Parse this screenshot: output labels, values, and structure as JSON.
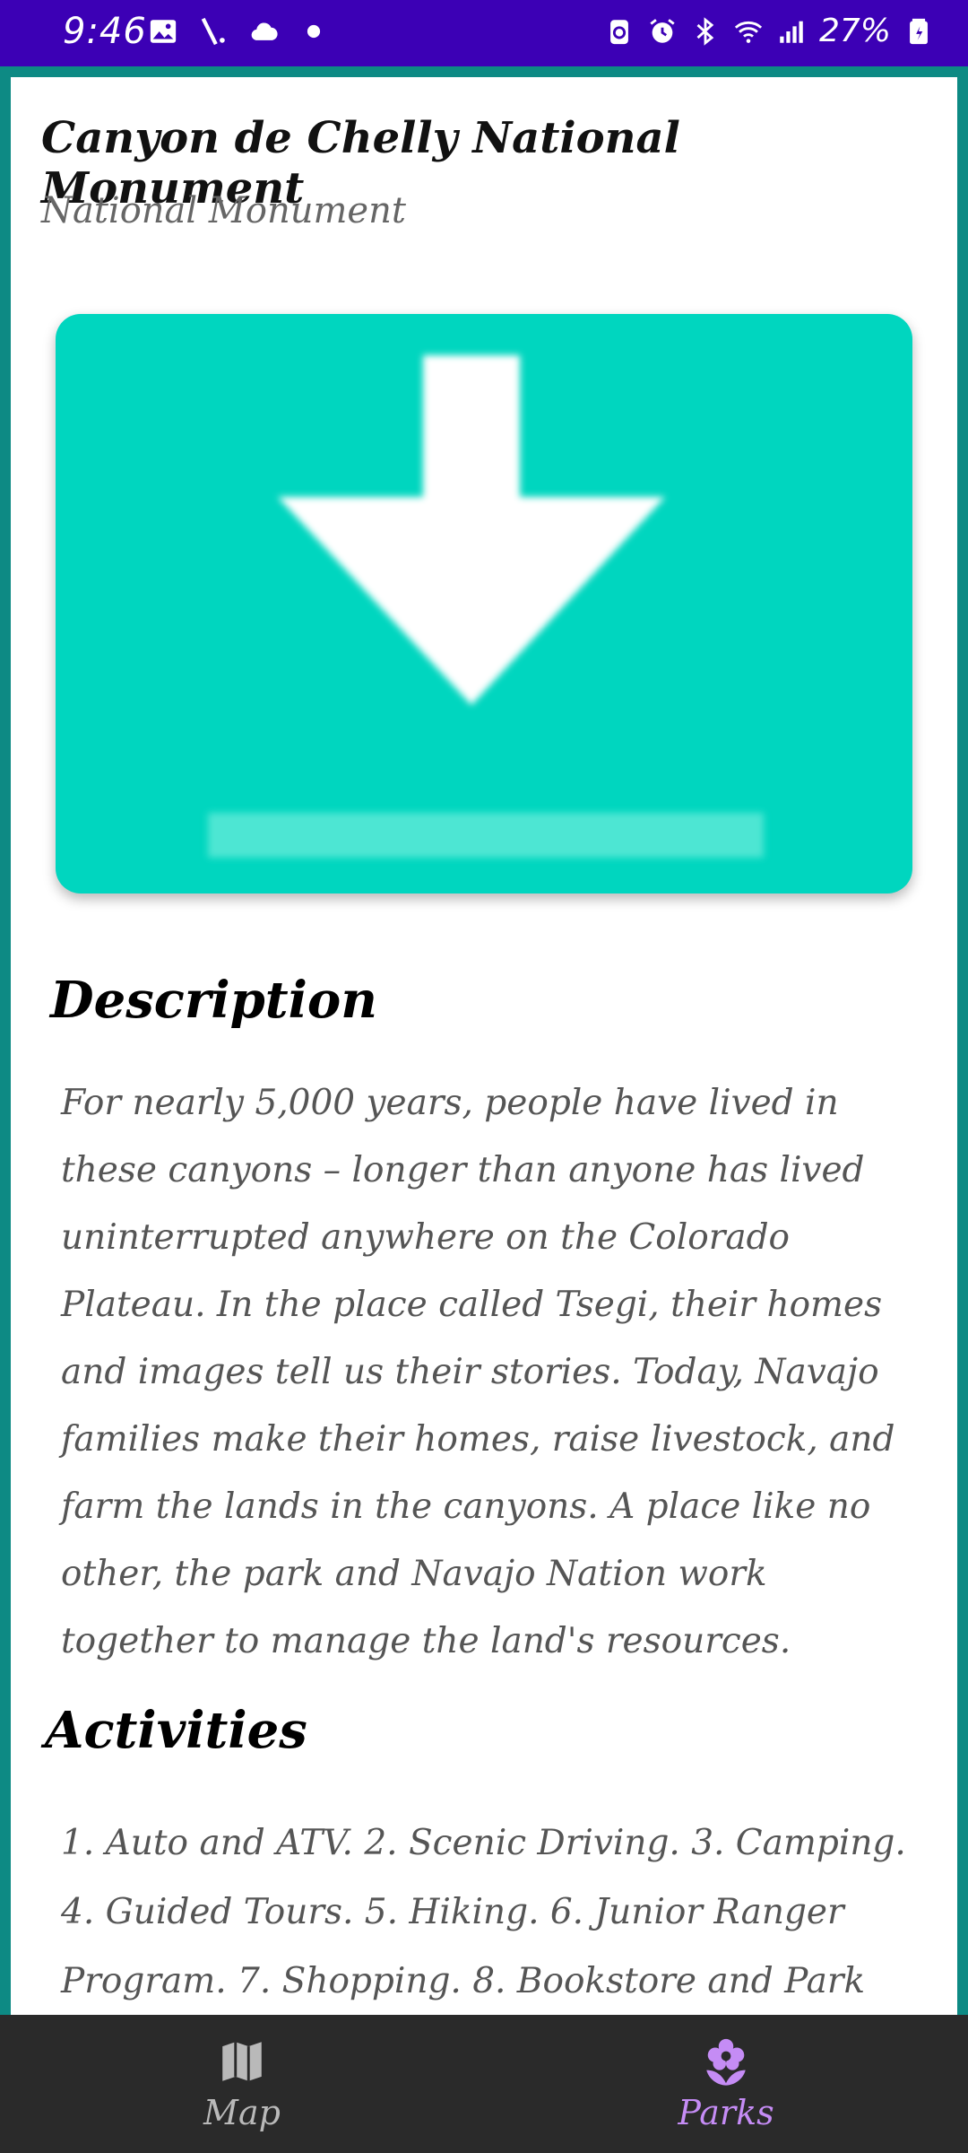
{
  "status_bar": {
    "time": "9:46",
    "battery": "27%",
    "background_color": "#3c00b5",
    "left_icons": [
      "image-icon",
      "signal-slash-icon",
      "cloud-icon",
      "dot-icon"
    ],
    "right_icons": [
      "battery-saver-icon",
      "alarm-icon",
      "bluetooth-icon",
      "wifi-icon",
      "cell-signal-icon",
      "battery-icon"
    ]
  },
  "park": {
    "title": "Canyon de Chelly National Monument",
    "designation": "National Monument",
    "image_placeholder_icon": "download-icon",
    "image_bg_color": "#00d6bf"
  },
  "description": {
    "heading": "Description",
    "text": "For nearly 5,000 years, people have lived in these canyons – longer than anyone has lived uninterrupted anywhere on the Colorado Plateau. In the place called Tsegi, their homes and images tell us their stories. Today, Navajo families make their homes, raise livestock, and farm the lands in the canyons. A place like no other, the park and Navajo Nation work together to manage the land's resources."
  },
  "activities": {
    "heading": "Activities",
    "text": "1. Auto and ATV. 2. Scenic Driving. 3. Camping. 4. Guided Tours. 5. Hiking. 6. Junior Ranger Program. 7. Shopping. 8. Bookstore and Park"
  },
  "bottom_nav": {
    "items": [
      {
        "label": "Map",
        "icon": "map-icon",
        "selected": false
      },
      {
        "label": "Parks",
        "icon": "flower-icon",
        "selected": true
      }
    ],
    "selected_color": "#c58cf5"
  }
}
